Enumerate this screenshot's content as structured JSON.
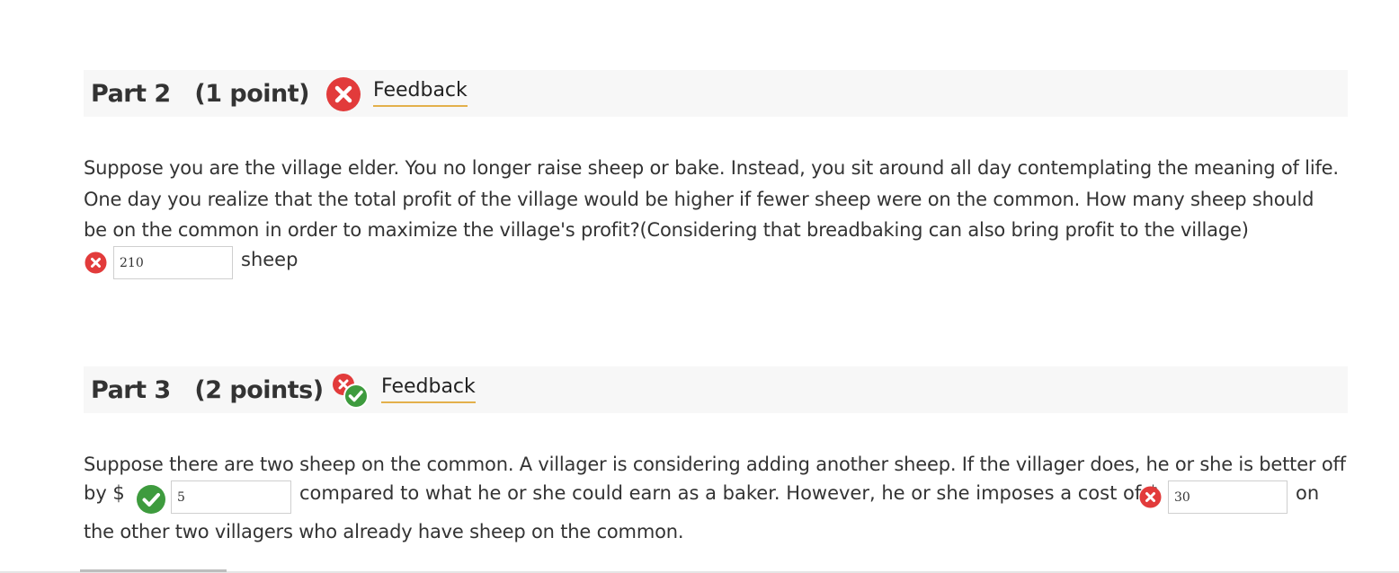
{
  "part2": {
    "title": "Part 2   (1 point)",
    "feedback_label": "Feedback",
    "status": "incorrect",
    "question": "Suppose you are the village elder. You no longer raise sheep or bake. Instead, you sit around all day contemplating the meaning of life. One day you realize that the total profit of the village would be higher if fewer sheep were on the common. How many sheep should be on the common in order to maximize the village's profit?(Considering that breadbaking can also bring profit to the village)",
    "answer_value": "210",
    "answer_status": "incorrect",
    "unit": "sheep"
  },
  "part3": {
    "title": "Part 3   (2 points)",
    "feedback_label": "Feedback",
    "status": "partially-correct",
    "question_line1": "Suppose there are two sheep on the common. A villager is considering adding another sheep. If the villager does, he or she is better off",
    "prefix1": "by $",
    "answer1_value": "5",
    "answer1_status": "correct",
    "middle_text": "compared to what he or she could earn as a baker. However, he or she imposes a cost of $",
    "answer2_value": "30",
    "answer2_status": "incorrect",
    "suffix2": "on",
    "question_line3": "the other two villagers who already have sheep on the common."
  },
  "icons": {
    "incorrect": "x-circle-icon",
    "correct": "check-circle-icon",
    "partial": "partial-credit-icon"
  },
  "colors": {
    "incorrect": "#e23b3b",
    "correct": "#3e9b3e",
    "feedback_underline": "#e3b04b",
    "header_bg": "#f7f7f7"
  }
}
